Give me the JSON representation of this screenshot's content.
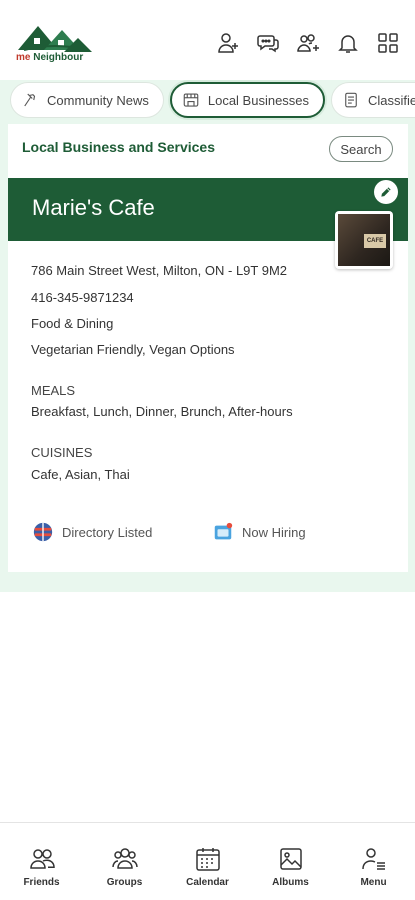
{
  "app": {
    "logo_text_me": "me",
    "logo_text_name": "Neighbour",
    "brand_color": "#1e5c36",
    "accent_red": "#c0392b"
  },
  "top_icons": [
    {
      "name": "add-friend-icon"
    },
    {
      "name": "chat-icon"
    },
    {
      "name": "group-add-icon"
    },
    {
      "name": "bell-icon"
    },
    {
      "name": "grid-apps-icon"
    }
  ],
  "tabs": [
    {
      "label": "Community News",
      "icon": "news-icon",
      "active": false
    },
    {
      "label": "Local Businesses",
      "icon": "store-icon",
      "active": true
    },
    {
      "label": "Classified",
      "icon": "classified-icon",
      "active": false
    }
  ],
  "section": {
    "title": "Local Business and Services",
    "search_label": "Search"
  },
  "business": {
    "name": "Marie's Cafe",
    "photo_sign": "CAFE",
    "address": "786 Main Street West, Milton, ON - L9T 9M2",
    "phone": "416-345-9871234",
    "category": "Food & Dining",
    "features": "Vegetarian Friendly, Vegan Options",
    "meals_label": "MEALS",
    "meals": "Breakfast, Lunch, Dinner, Brunch, After-hours",
    "cuisines_label": "CUISINES",
    "cuisines": "Cafe, Asian, Thai",
    "badges": [
      {
        "label": "Directory Listed",
        "icon": "directory-globe-icon"
      },
      {
        "label": "Now Hiring",
        "icon": "hiring-icon"
      }
    ]
  },
  "bottom_nav": [
    {
      "label": "Friends",
      "icon": "friends-icon"
    },
    {
      "label": "Groups",
      "icon": "groups-icon"
    },
    {
      "label": "Calendar",
      "icon": "calendar-icon"
    },
    {
      "label": "Albums",
      "icon": "albums-icon"
    },
    {
      "label": "Menu",
      "icon": "menu-icon"
    }
  ]
}
